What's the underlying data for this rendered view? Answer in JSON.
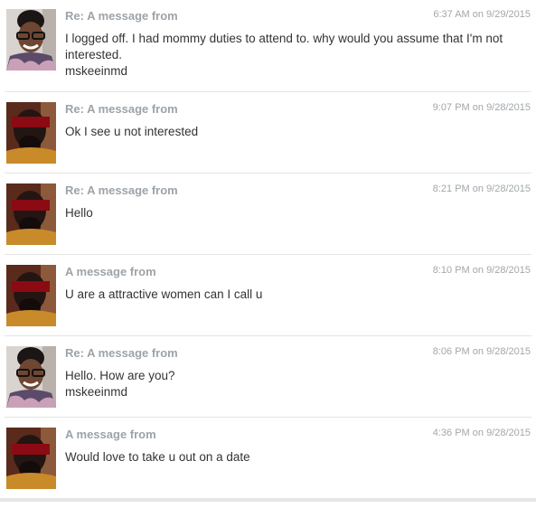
{
  "messages": [
    {
      "subject": "Re: A message from",
      "time": "6:37 AM on 9/29/2015",
      "lines": [
        "I logged off. I had mommy duties to attend to. why would you assume that I'm not interested.",
        "mskeeinmd"
      ],
      "avatar": "woman-glasses"
    },
    {
      "subject": "Re: A message from",
      "time": "9:07 PM on 9/28/2015",
      "lines": [
        "Ok I see u not interested"
      ],
      "avatar": "man-redacted"
    },
    {
      "subject": "Re: A message from",
      "time": "8:21 PM on 9/28/2015",
      "lines": [
        "Hello"
      ],
      "avatar": "man-redacted"
    },
    {
      "subject": "A message from",
      "time": "8:10 PM on 9/28/2015",
      "lines": [
        "U are a attractive women can I call u"
      ],
      "avatar": "man-redacted"
    },
    {
      "subject": "Re: A message from",
      "time": "8:06 PM on 9/28/2015",
      "lines": [
        "Hello. How are you?",
        "mskeeinmd"
      ],
      "avatar": "woman-glasses"
    },
    {
      "subject": "A message from",
      "time": "4:36 PM on 9/28/2015",
      "lines": [
        "Would love to take u out on a date"
      ],
      "avatar": "man-redacted"
    }
  ],
  "colors": {
    "subject": "#9da3a8",
    "time": "#a2a7ab",
    "body": "#333333",
    "redaction": "#8b0a14"
  }
}
